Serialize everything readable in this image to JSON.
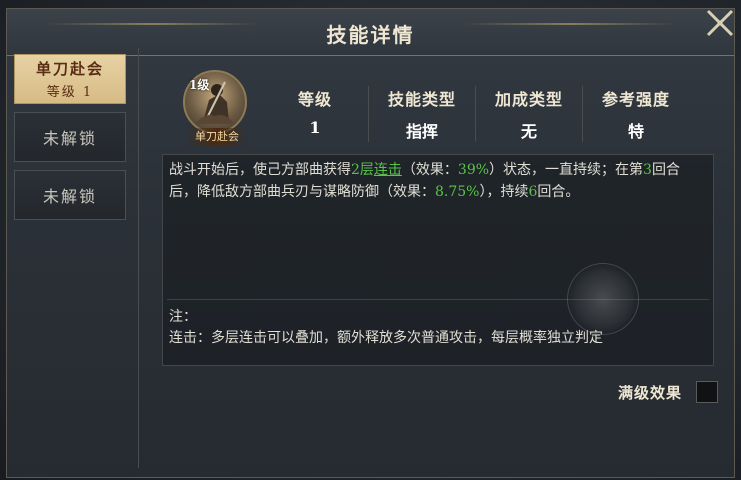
{
  "title": "技能详情",
  "sidebar": {
    "items": [
      {
        "name": "单刀赴会",
        "level": "等级 1",
        "active": true
      },
      {
        "label": "未解锁"
      },
      {
        "label": "未解锁"
      }
    ]
  },
  "skill": {
    "level_badge": "1级",
    "name": "单刀赴会",
    "stats": [
      {
        "header": "等级",
        "value": "1"
      },
      {
        "header": "技能类型",
        "value": "指挥"
      },
      {
        "header": "加成类型",
        "value": "无"
      },
      {
        "header": "参考强度",
        "value": "特"
      }
    ],
    "description": {
      "p1": "战斗开始后，使己方部曲获得",
      "layers": "2层",
      "effect_link": "连击",
      "p2": "（效果：",
      "pct1": "39%",
      "p3": "）状态，一直持续；在第",
      "round": "3",
      "p4": "回合后，降低敌方部曲兵刃与谋略防御（效果：",
      "pct2": "8.75%",
      "p5": "），持续",
      "duration": "6",
      "p6": "回合。"
    },
    "note_label": "注：",
    "note_text": "连击：多层连击可以叠加，额外释放多次普通攻击，每层概率独立判定"
  },
  "max_level_effect_label": "满级效果",
  "colors": {
    "highlight": "#59c248",
    "active_tab": "#d7bb85"
  }
}
